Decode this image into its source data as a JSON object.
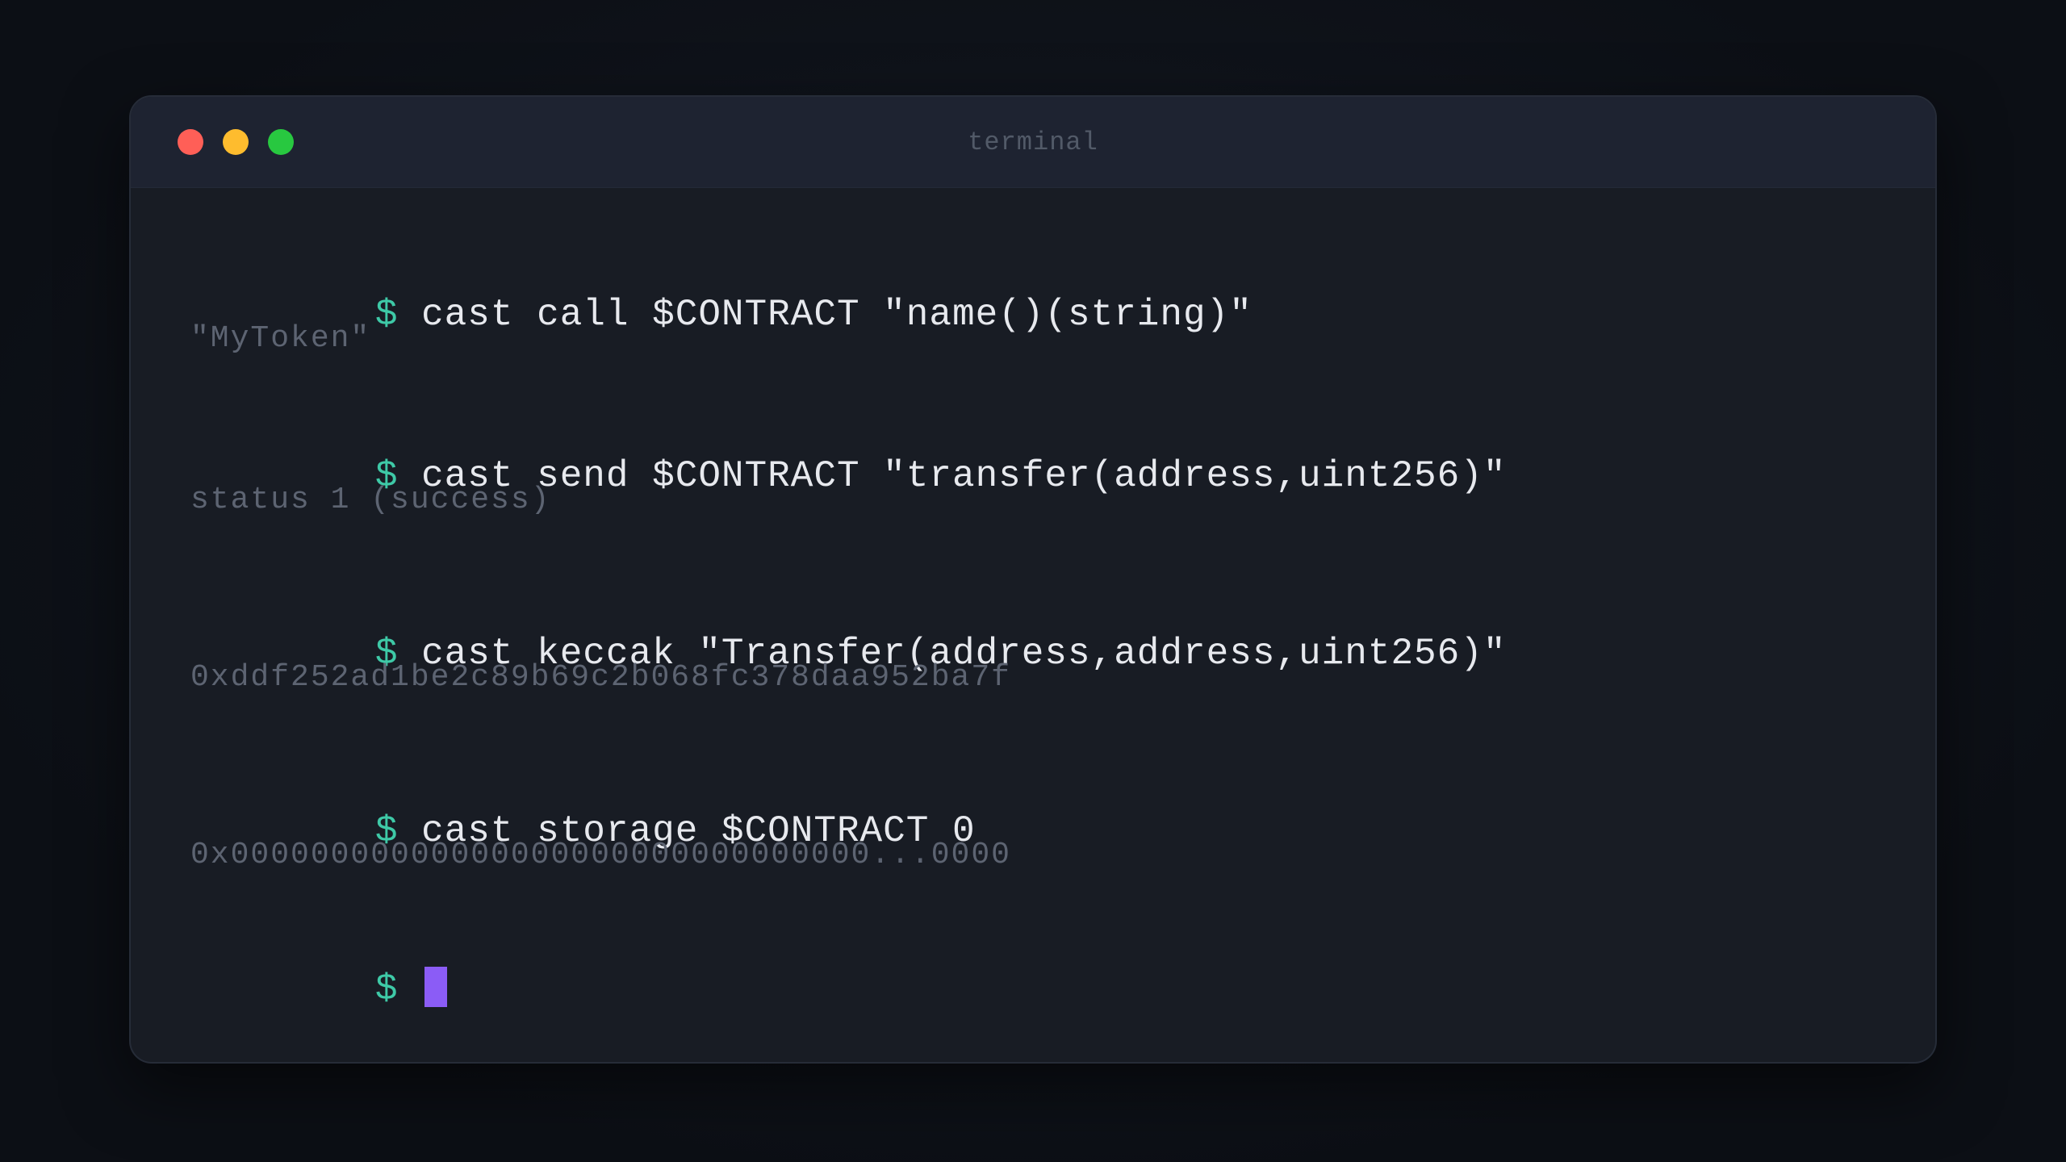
{
  "window": {
    "title": "terminal",
    "controls": {
      "close_color": "#ff5f57",
      "minimize_color": "#febc2e",
      "maximize_color": "#28c840"
    }
  },
  "terminal": {
    "prompt_symbol": "$",
    "prompt_color": "#3ec9a7",
    "cursor_color": "#8b5cf6",
    "entries": [
      {
        "command": "cast call $CONTRACT \"name()(string)\"",
        "output": "\"MyToken\""
      },
      {
        "command": "cast send $CONTRACT \"transfer(address,uint256)\"",
        "output": "status 1 (success)"
      },
      {
        "command": "cast keccak \"Transfer(address,address,uint256)\"",
        "output": "0xddf252ad1be2c89b69c2b068fc378daa952ba7f"
      },
      {
        "command": "cast storage $CONTRACT 0",
        "output": "0x00000000000000000000000000000000...0000"
      }
    ],
    "current_input": ""
  }
}
